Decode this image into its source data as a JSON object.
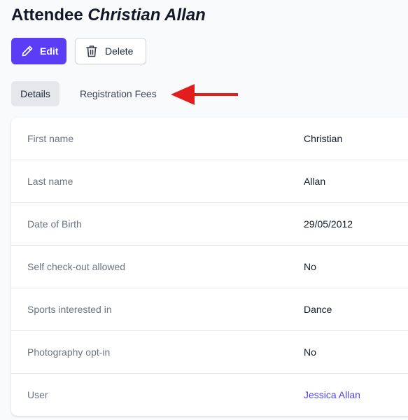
{
  "header": {
    "title_prefix": "Attendee",
    "title_name": "Christian Allan"
  },
  "actions": {
    "edit_label": "Edit",
    "delete_label": "Delete"
  },
  "tabs": [
    {
      "label": "Details",
      "active": true
    },
    {
      "label": "Registration Fees",
      "active": false
    }
  ],
  "annotation": {
    "arrow_color": "#e11d1d"
  },
  "details": [
    {
      "label": "First name",
      "value": "Christian"
    },
    {
      "label": "Last name",
      "value": "Allan"
    },
    {
      "label": "Date of Birth",
      "value": "29/05/2012"
    },
    {
      "label": "Self check-out allowed",
      "value": "No"
    },
    {
      "label": "Sports interested in",
      "value": "Dance"
    },
    {
      "label": "Photography opt-in",
      "value": "No"
    },
    {
      "label": "User",
      "value": "Jessica Allan",
      "link": true
    }
  ],
  "colors": {
    "primary": "#5b3df5",
    "link": "#4f46e5"
  }
}
